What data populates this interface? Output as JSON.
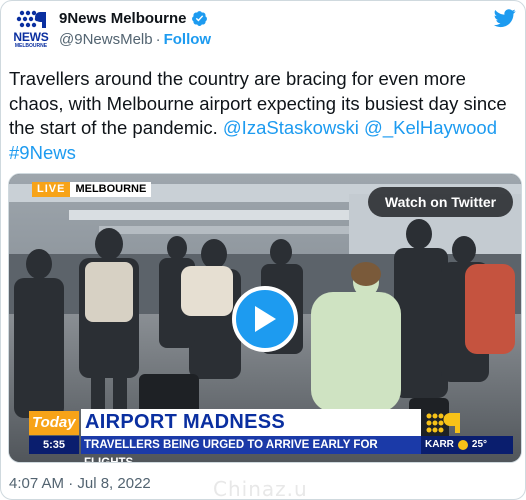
{
  "author": {
    "name": "9News Melbourne",
    "handle": "@9NewsMelb",
    "separator": "·",
    "follow_label": "Follow",
    "avatar_text": "NEWS",
    "avatar_subtext": "MELBOURNE"
  },
  "tweet": {
    "text_plain": "Travellers around the country are bracing for even more chaos, with Melbourne airport expecting its busiest day since the start of the pandemic. ",
    "mention_1": "@IzaStaskowski",
    "mention_2": "@_KelHaywood",
    "hashtag": "#9News"
  },
  "media": {
    "live_label": "LIVE",
    "location": "MELBOURNE",
    "watch_label": "Watch on Twitter",
    "program": "Today",
    "time": "5:35",
    "headline": "AIRPORT MADNESS",
    "subheadline": "TRAVELLERS BEING URGED TO ARRIVE EARLY FOR FLIGHTS",
    "weather_location": "KARR",
    "weather_temp": "25°"
  },
  "footer": {
    "timestamp": "4:07 AM · Jul 8, 2022"
  },
  "watermark": "Chinaz.u",
  "colors": {
    "accent": "#1d9bf0",
    "brand_blue": "#0a2fa0",
    "today_orange": "#f7a318"
  },
  "icons": [
    "verified-badge-icon",
    "twitter-bird-icon",
    "play-icon",
    "nine-logo-icon"
  ]
}
